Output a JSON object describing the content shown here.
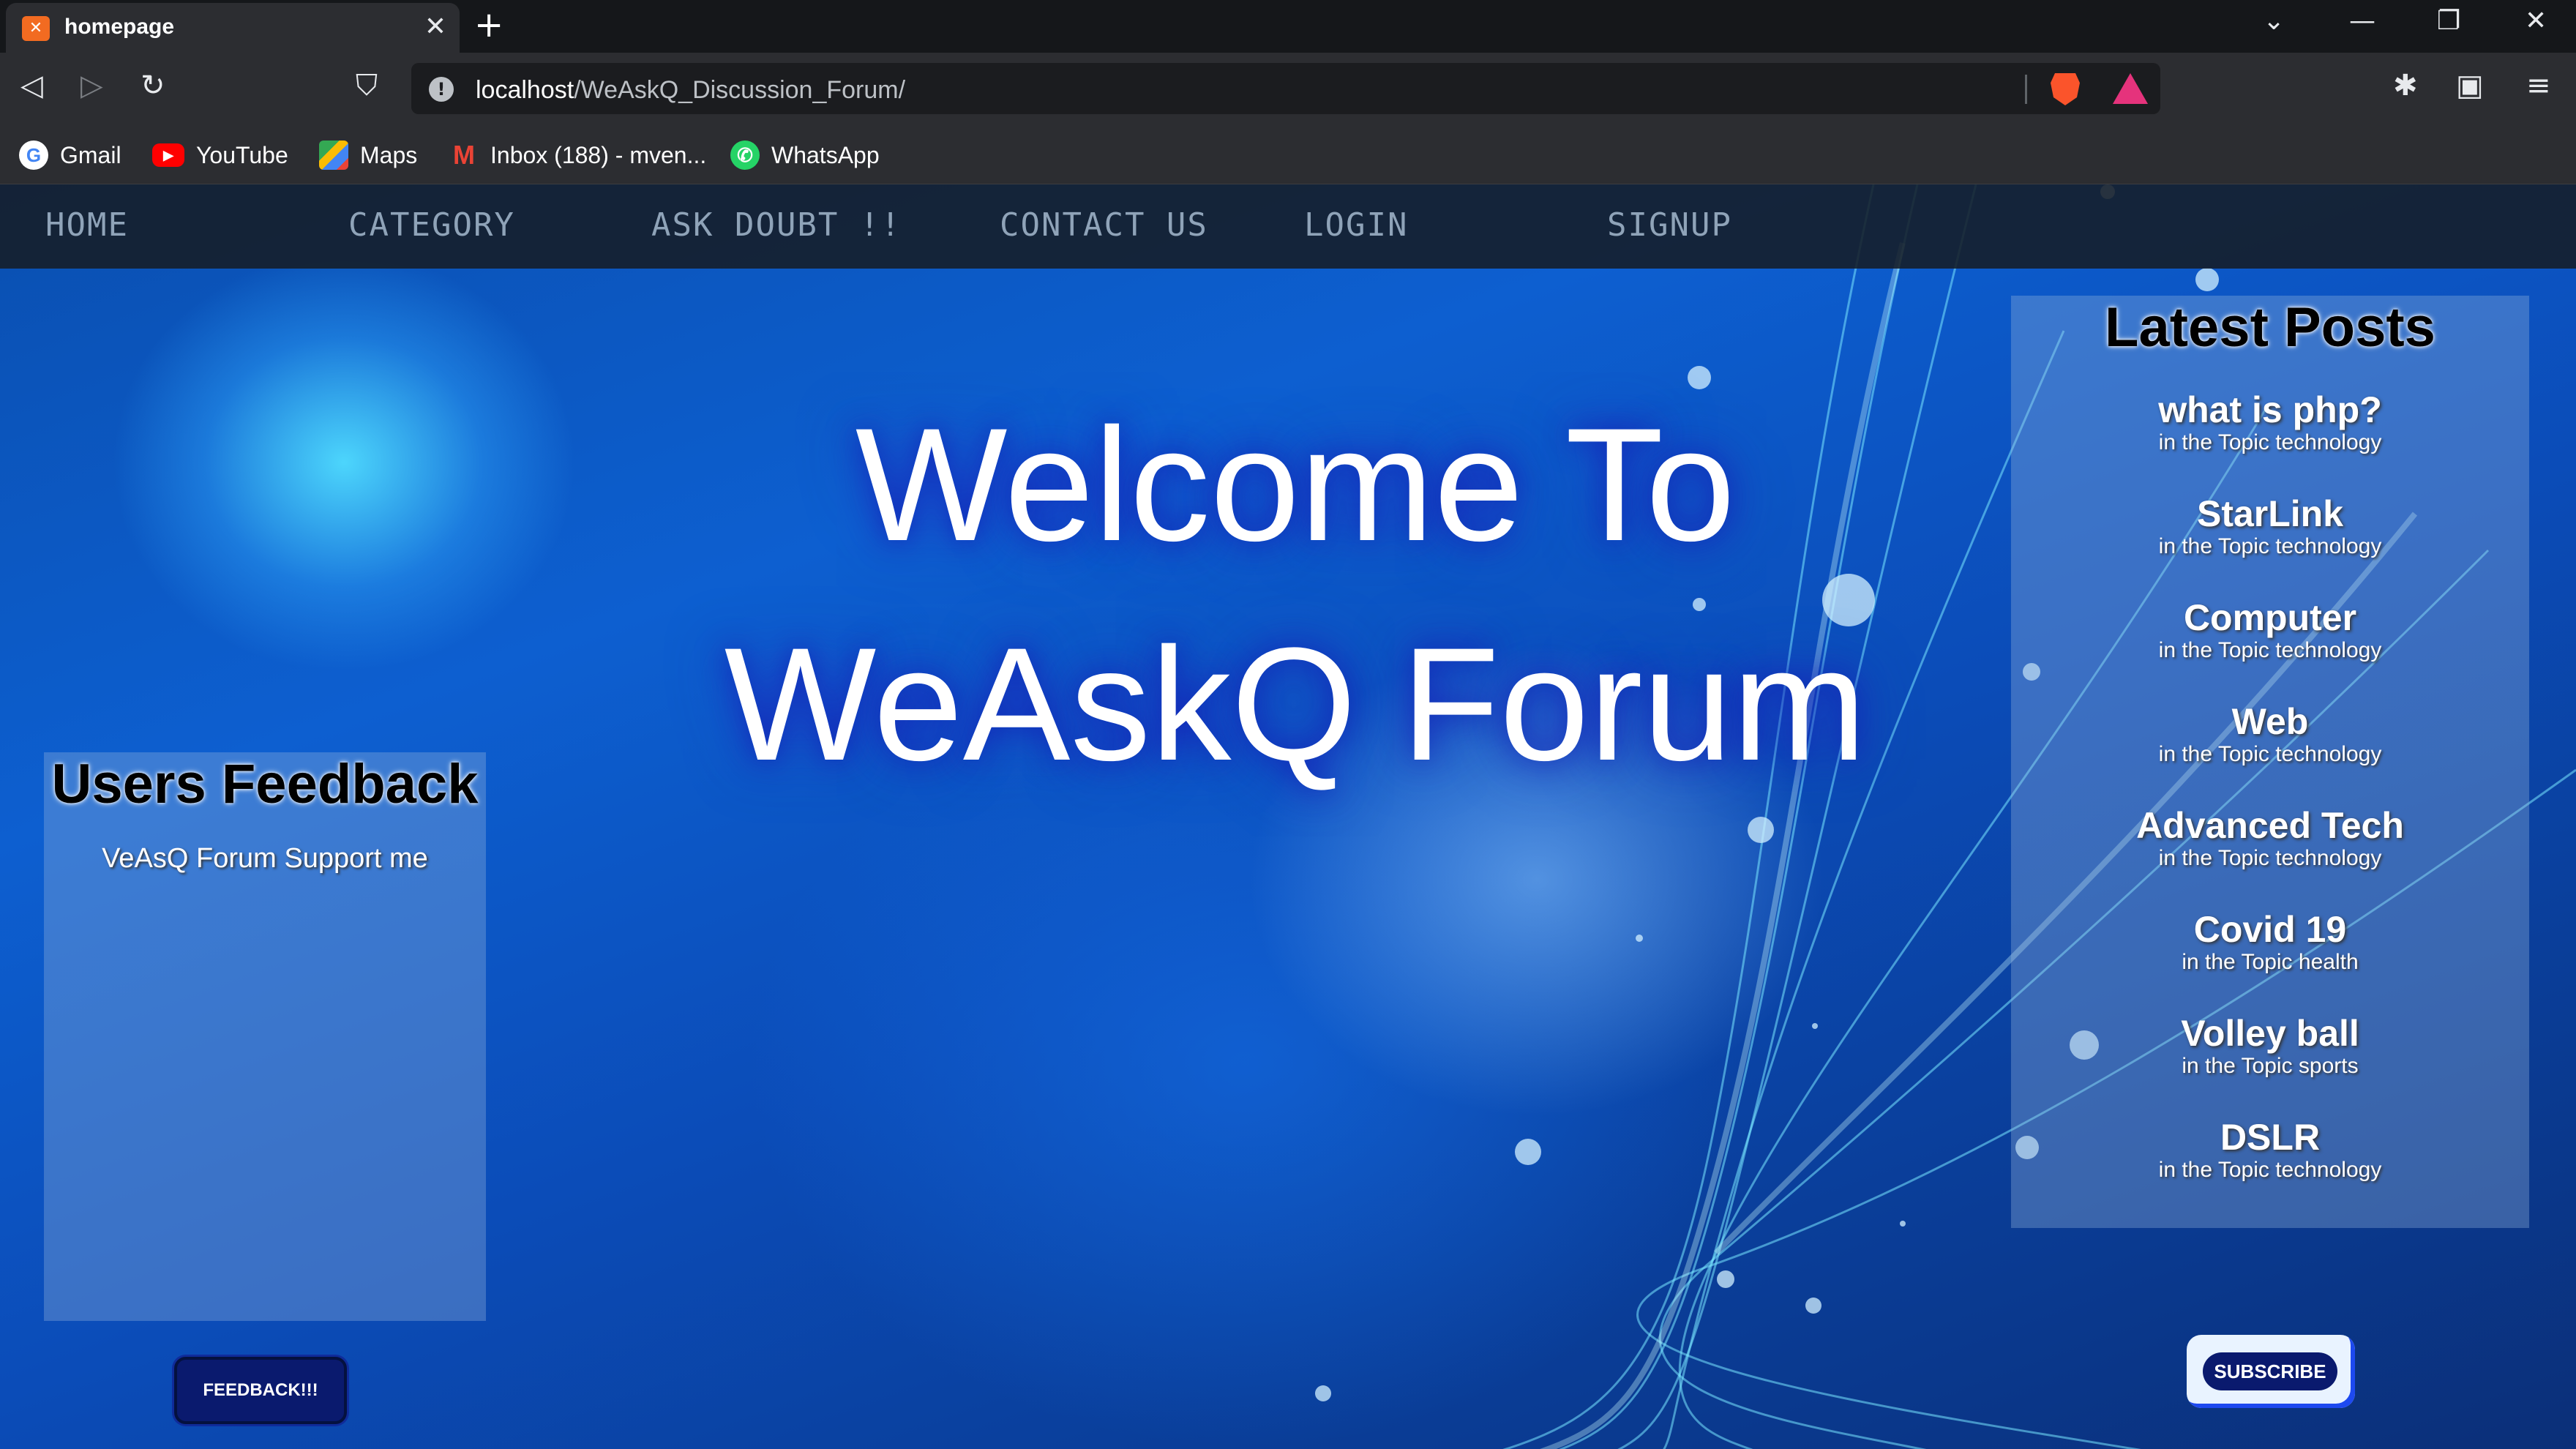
{
  "browser": {
    "tab_title": "homepage",
    "tab_favicon": "xampp-icon",
    "new_tab_label": "+",
    "url_host": "localhost",
    "url_path": "/WeAskQ_Discussion_Forum/",
    "bookmarks": [
      {
        "label": "Gmail",
        "icon": "google-icon"
      },
      {
        "label": "YouTube",
        "icon": "youtube-icon"
      },
      {
        "label": "Maps",
        "icon": "maps-icon"
      },
      {
        "label": "Inbox (188) - mven...",
        "icon": "gmail-icon"
      },
      {
        "label": "WhatsApp",
        "icon": "whatsapp-icon"
      }
    ]
  },
  "nav": {
    "home": "HOME",
    "category": "CATEGORY",
    "ask": "ASK DOUBT !!",
    "contact": "CONTACT US",
    "login": "LOGIN",
    "signup": "SIGNUP"
  },
  "hero": {
    "line1": "Welcome To",
    "line2": "WeAskQ Forum"
  },
  "feedback": {
    "title": "Users Feedback",
    "items": [
      "VeAsQ Forum Support me"
    ],
    "button": "FEEDBACK!!!"
  },
  "latest_posts": {
    "title": "Latest Posts",
    "posts": [
      {
        "title": "what is php?",
        "topic": "in the Topic technology"
      },
      {
        "title": "StarLink",
        "topic": "in the Topic technology"
      },
      {
        "title": "Computer",
        "topic": "in the Topic technology"
      },
      {
        "title": "Web",
        "topic": "in the Topic technology"
      },
      {
        "title": "Advanced Tech",
        "topic": "in the Topic technology"
      },
      {
        "title": "Covid 19",
        "topic": "in the Topic health"
      },
      {
        "title": "Volley ball",
        "topic": "in the Topic sports"
      },
      {
        "title": "DSLR",
        "topic": "in the Topic technology"
      }
    ]
  },
  "subscribe": {
    "button": "SUBSCRIBE"
  },
  "colors": {
    "background_blue": "#0d5fd0",
    "navbar": "#161c26",
    "nav_text": "#8fa3b8",
    "button_navy": "#0a1a6e"
  }
}
